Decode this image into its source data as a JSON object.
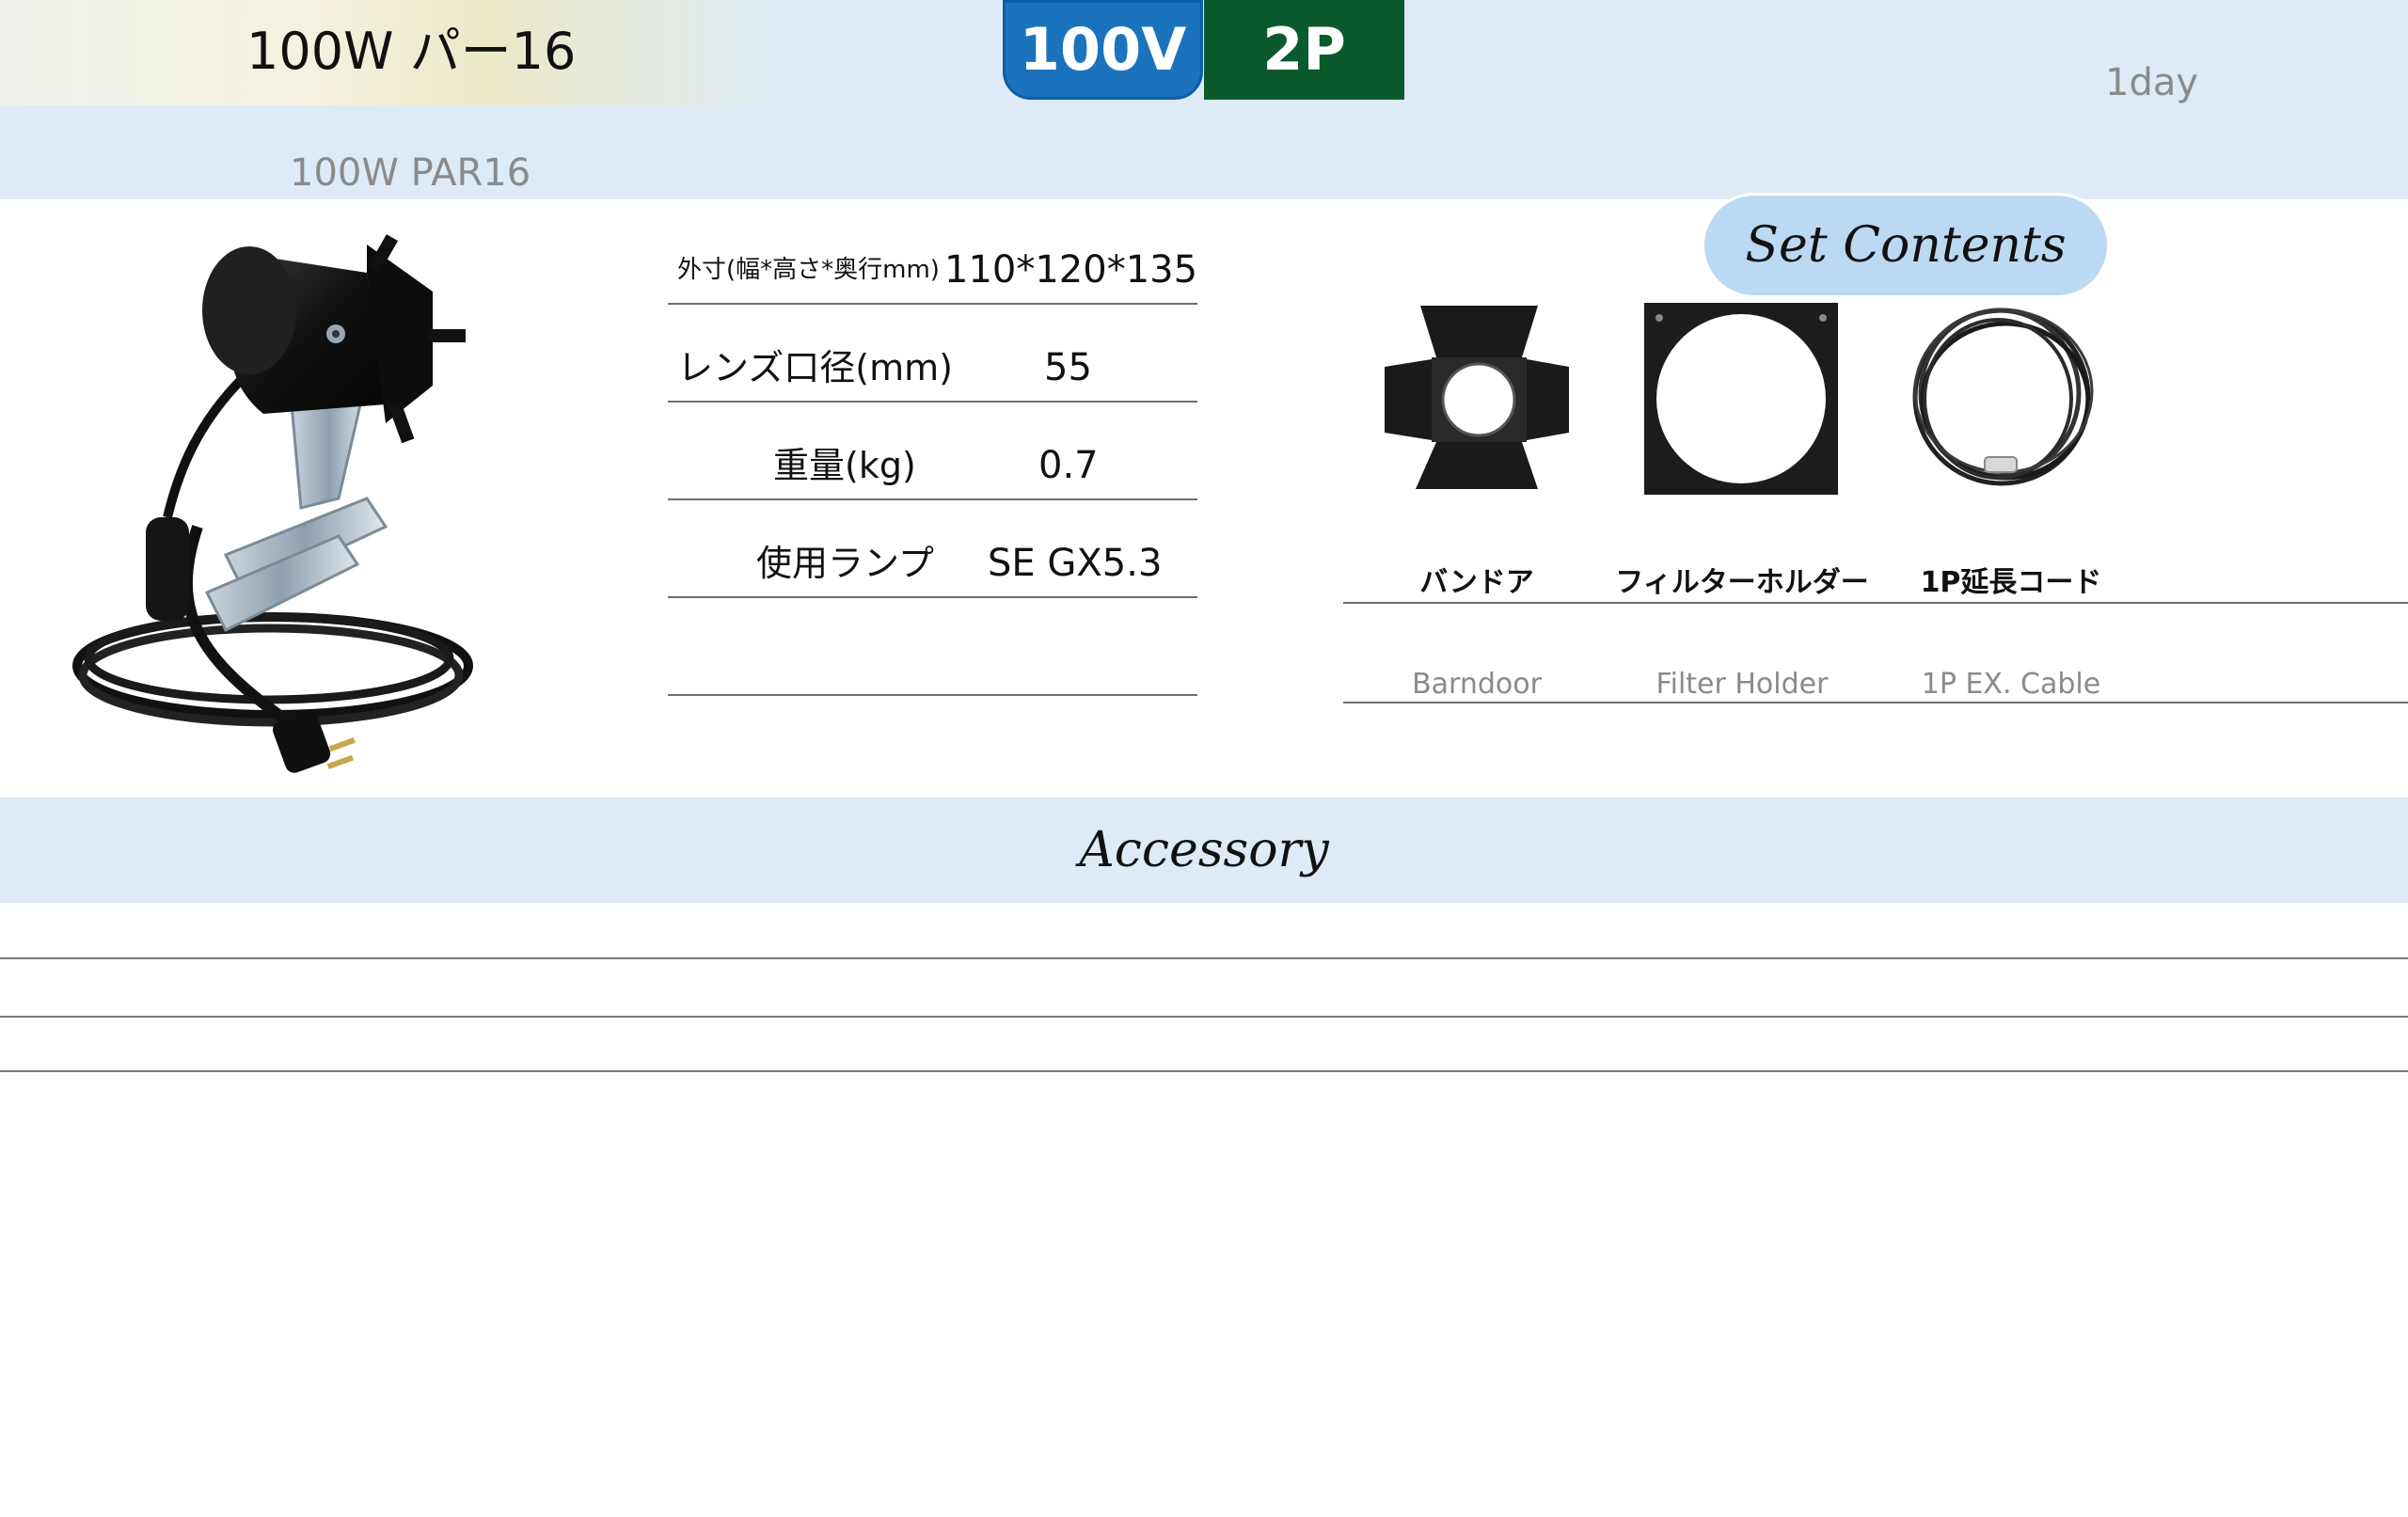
{
  "header": {
    "title_jp": "100W パー16",
    "title_en": "100W PAR16",
    "voltage_badge": "100V",
    "plug_badge": "2P",
    "rental_term": "1day"
  },
  "specs": [
    {
      "label": "外寸(幅*高さ*奥行mm)",
      "value": "110*120*135"
    },
    {
      "label": "レンズ口径(mm)",
      "value": "55"
    },
    {
      "label": "重量(kg)",
      "value": "0.7"
    },
    {
      "label": "使用ランプ",
      "value": "SE GX5.3"
    },
    {
      "label": "",
      "value": ""
    }
  ],
  "set_contents": {
    "title": "Set Contents",
    "items": [
      {
        "name_jp": "バンドア",
        "name_en": "Barndoor",
        "icon": "barndoor-icon"
      },
      {
        "name_jp": "フィルターホルダー",
        "name_en": "Filter Holder",
        "icon": "filter-holder-icon"
      },
      {
        "name_jp": "1P延長コード",
        "name_en": "1P EX. Cable",
        "icon": "cable-icon"
      }
    ]
  },
  "accessory": {
    "title": "Accessory"
  },
  "colors": {
    "band": "#deebf6",
    "voltage_badge": "#1b73bd",
    "plug_badge": "#0a5a2c",
    "set_tag": "#bcd9f3"
  }
}
